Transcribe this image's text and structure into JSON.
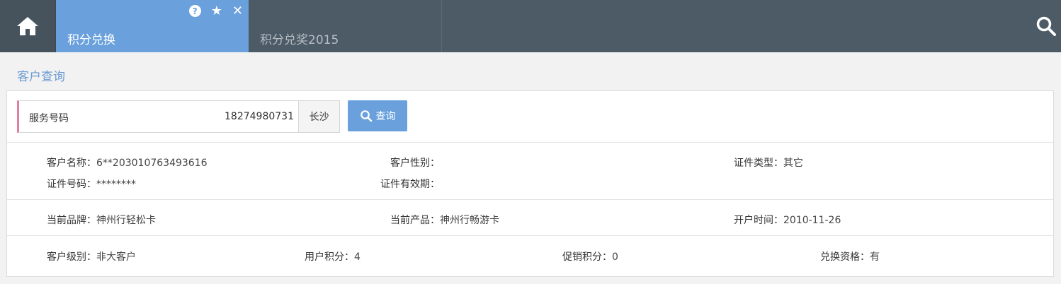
{
  "tabs": [
    {
      "label": "积分兑换"
    },
    {
      "label": "积分兑奖2015"
    }
  ],
  "tab_icons": {
    "help": "?",
    "star": "★",
    "close": "✕"
  },
  "section_title": "客户查询",
  "query": {
    "label": "服务号码",
    "value": "18274980731",
    "city": "长沙",
    "button_label": "查询"
  },
  "info": {
    "customer_name": {
      "label": "客户名称：",
      "value": "6**203010763493616"
    },
    "gender": {
      "label": "客户性别：",
      "value": ""
    },
    "id_type": {
      "label": "证件类型：",
      "value": "其它"
    },
    "id_number": {
      "label": "证件号码：",
      "value": "********"
    },
    "id_validity": {
      "label": "证件有效期：",
      "value": ""
    },
    "brand": {
      "label": "当前品牌：",
      "value": "神州行轻松卡"
    },
    "product": {
      "label": "当前产品：",
      "value": "神州行畅游卡"
    },
    "open_time": {
      "label": "开户时间：",
      "value": "2010-11-26"
    },
    "level": {
      "label": "客户级别：",
      "value": "非大客户"
    },
    "user_points": {
      "label": "用户积分：",
      "value": "4"
    },
    "promo_points": {
      "label": "促销积分：",
      "value": "0"
    },
    "eligibility": {
      "label": "兑换资格：",
      "value": "有"
    }
  },
  "colors": {
    "topbar": "#4d5b66",
    "accent": "#6aa1dd",
    "query_border": "#e07fa4"
  }
}
